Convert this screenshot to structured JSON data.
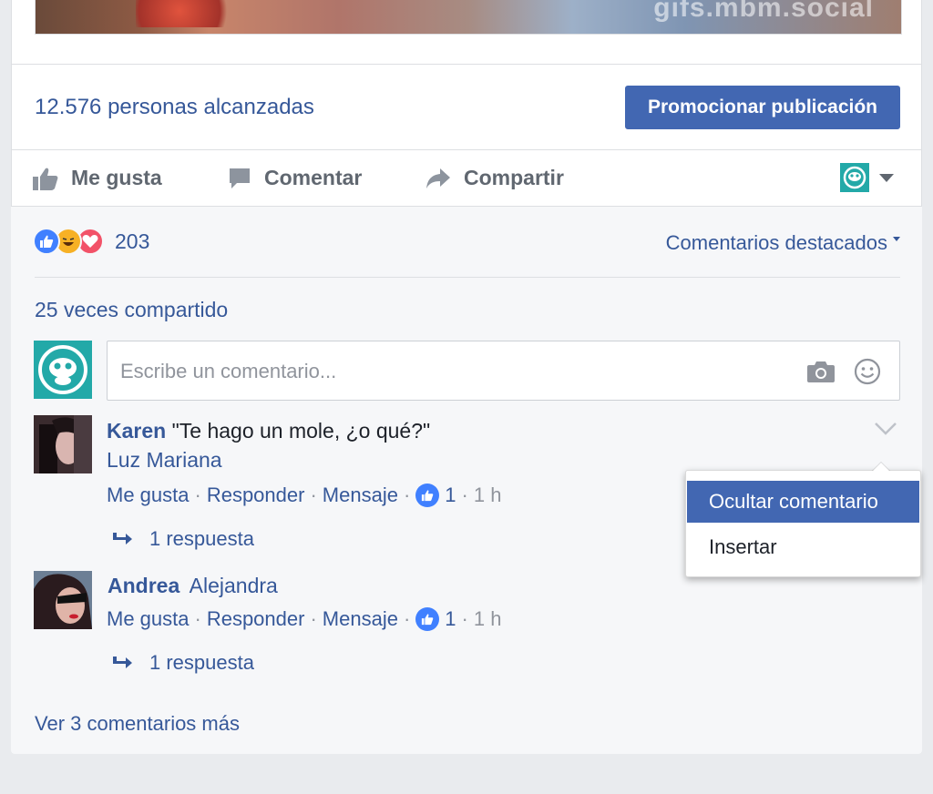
{
  "post": {
    "photo_watermark": "gifs.mbm.social",
    "reach_text": "12.576 personas alcanzadas",
    "promote_label": "Promocionar publicación"
  },
  "actions": {
    "like": "Me gusta",
    "comment": "Comentar",
    "share": "Compartir"
  },
  "reactions": {
    "icons": [
      "like-icon",
      "haha-icon",
      "love-icon"
    ],
    "count": "203"
  },
  "featured_label": "Comentarios destacados",
  "shares_text": "25 veces compartido",
  "composer": {
    "placeholder": "Escribe un comentario..."
  },
  "comments": [
    {
      "author": "Karen",
      "text": "\"Te hago un mole, ¿o qué?\"",
      "mention": "Luz Mariana",
      "like": "Me gusta",
      "reply": "Responder",
      "message": "Mensaje",
      "likes": "1",
      "time": "1 h",
      "replies": "1 respuesta"
    },
    {
      "author": "Andrea",
      "mention": "Alejandra",
      "like": "Me gusta",
      "reply": "Responder",
      "message": "Mensaje",
      "likes": "1",
      "time": "1 h",
      "replies": "1 respuesta"
    }
  ],
  "menu": {
    "items": [
      "Ocultar comentario",
      "Insertar"
    ]
  },
  "more_comments": "Ver 3 comentarios más",
  "colors": {
    "accent": "#4267b2",
    "link": "#365899",
    "page_avatar": "#23a9a8"
  }
}
